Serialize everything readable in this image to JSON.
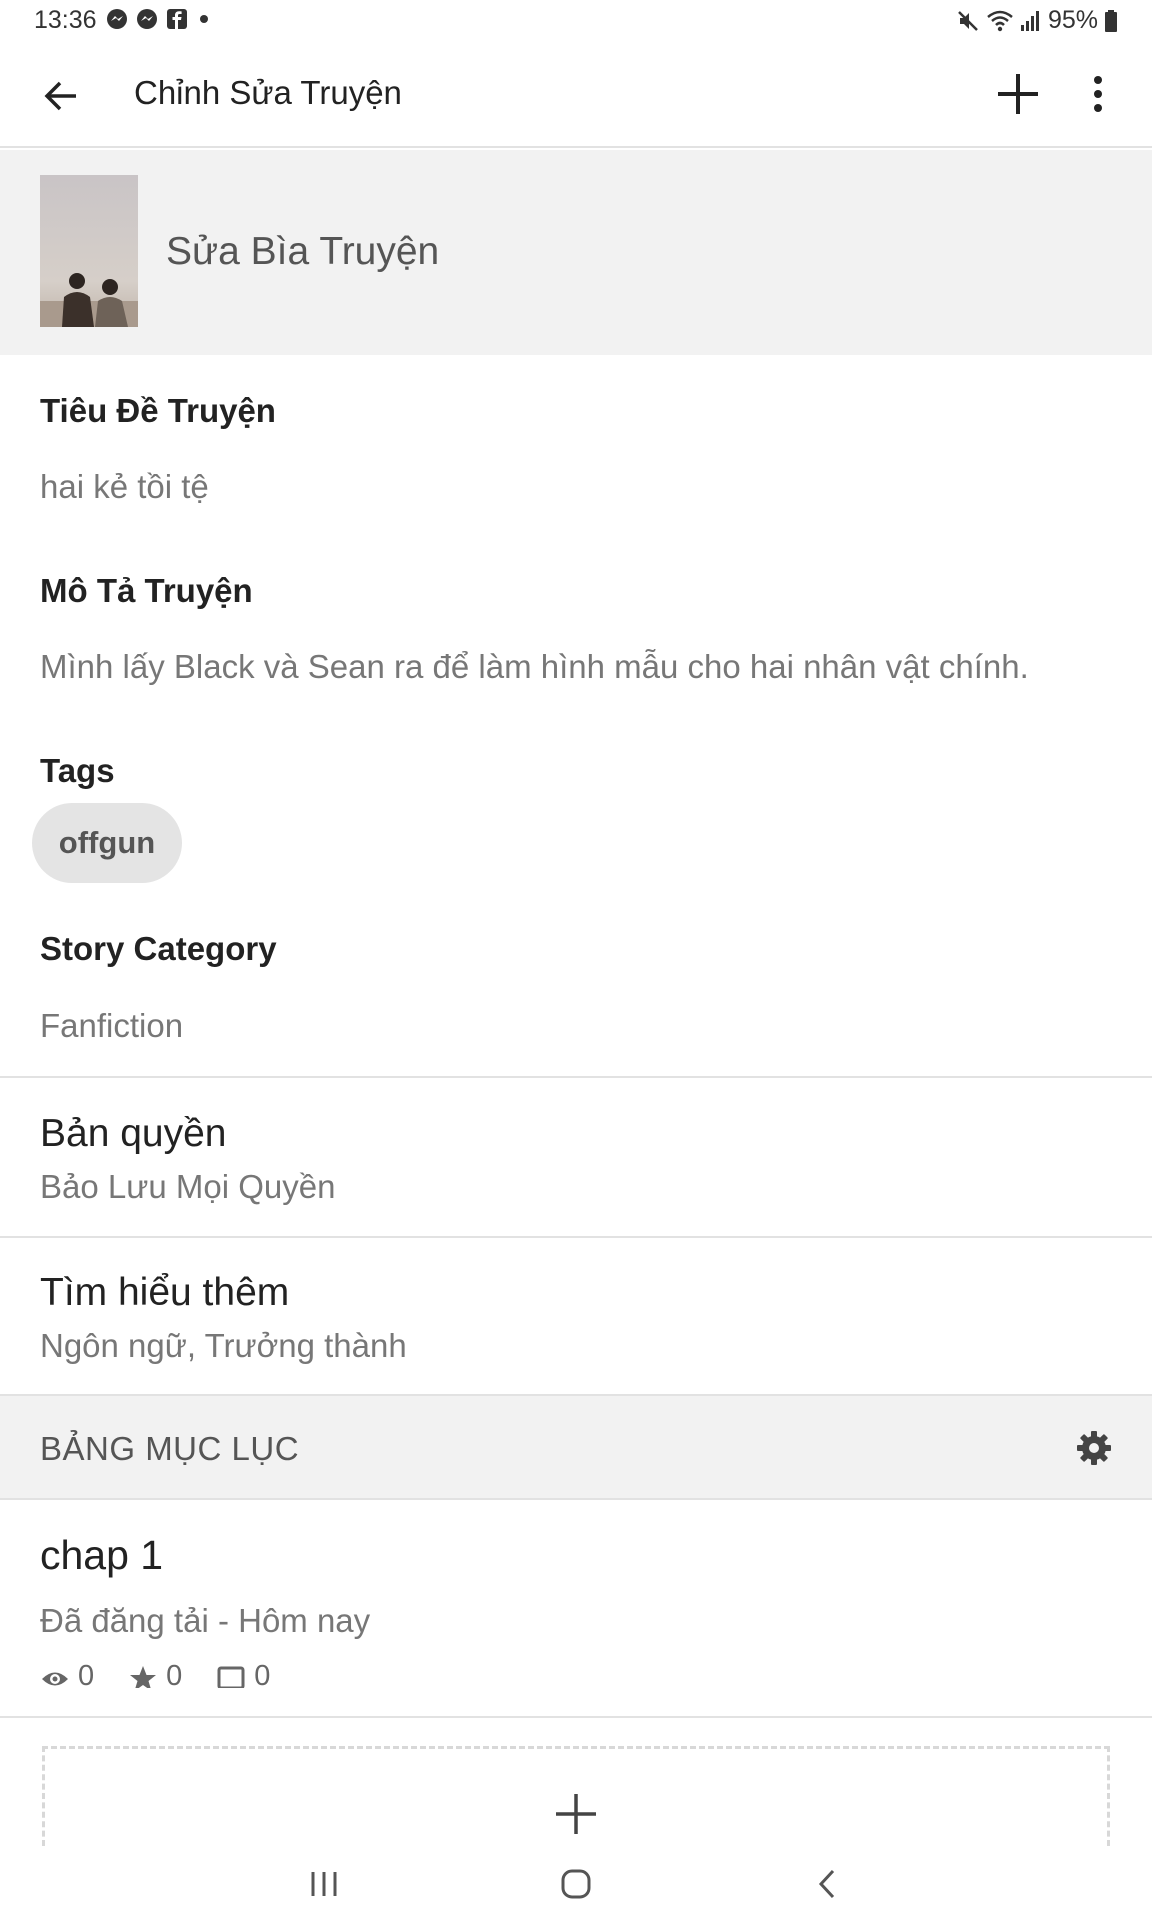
{
  "status_bar": {
    "time": "13:36",
    "battery": "95%",
    "left_icons": [
      "messenger-icon",
      "messenger-icon",
      "facebook-icon"
    ],
    "right_icons": [
      "mute-icon",
      "wifi-icon",
      "signal-icon",
      "battery-icon"
    ]
  },
  "app_bar": {
    "title": "Chỉnh Sửa Truyện",
    "back_icon": "arrow-left-icon",
    "add_icon": "plus-icon",
    "menu_icon": "more-vertical-icon"
  },
  "cover": {
    "label": "Sửa Bìa Truyện"
  },
  "story": {
    "title_label": "Tiêu Đề Truyện",
    "title_value": "hai kẻ tồi tệ",
    "description_label": "Mô Tả Truyện",
    "description_value": "Mình lấy Black và Sean ra để làm hình mẫu cho hai nhân vật chính.",
    "tags_label": "Tags",
    "tags": [
      "offgun"
    ],
    "category_label": "Story Category",
    "category_value": "Fanfiction"
  },
  "copyright": {
    "title": "Bản quyền",
    "value": "Bảo Lưu Mọi Quyền"
  },
  "learn_more": {
    "title": "Tìm hiểu thêm",
    "value": "Ngôn ngữ, Trưởng thành"
  },
  "toc": {
    "header": "BẢNG MỤC LỤC",
    "settings_icon": "gear-icon",
    "chapters": [
      {
        "title": "chap 1",
        "status": "Đã đăng tải - Hôm nay",
        "views": "0",
        "votes": "0",
        "comments": "0"
      }
    ]
  },
  "nav_bar": {
    "icons": [
      "recent-apps-icon",
      "home-icon",
      "back-icon"
    ]
  },
  "colors": {
    "section_background": "#f2f2f2",
    "divider": "#e2e2e2",
    "primary_text": "#222222",
    "secondary_text": "#777777",
    "tag_chip": "#e4e4e4"
  }
}
